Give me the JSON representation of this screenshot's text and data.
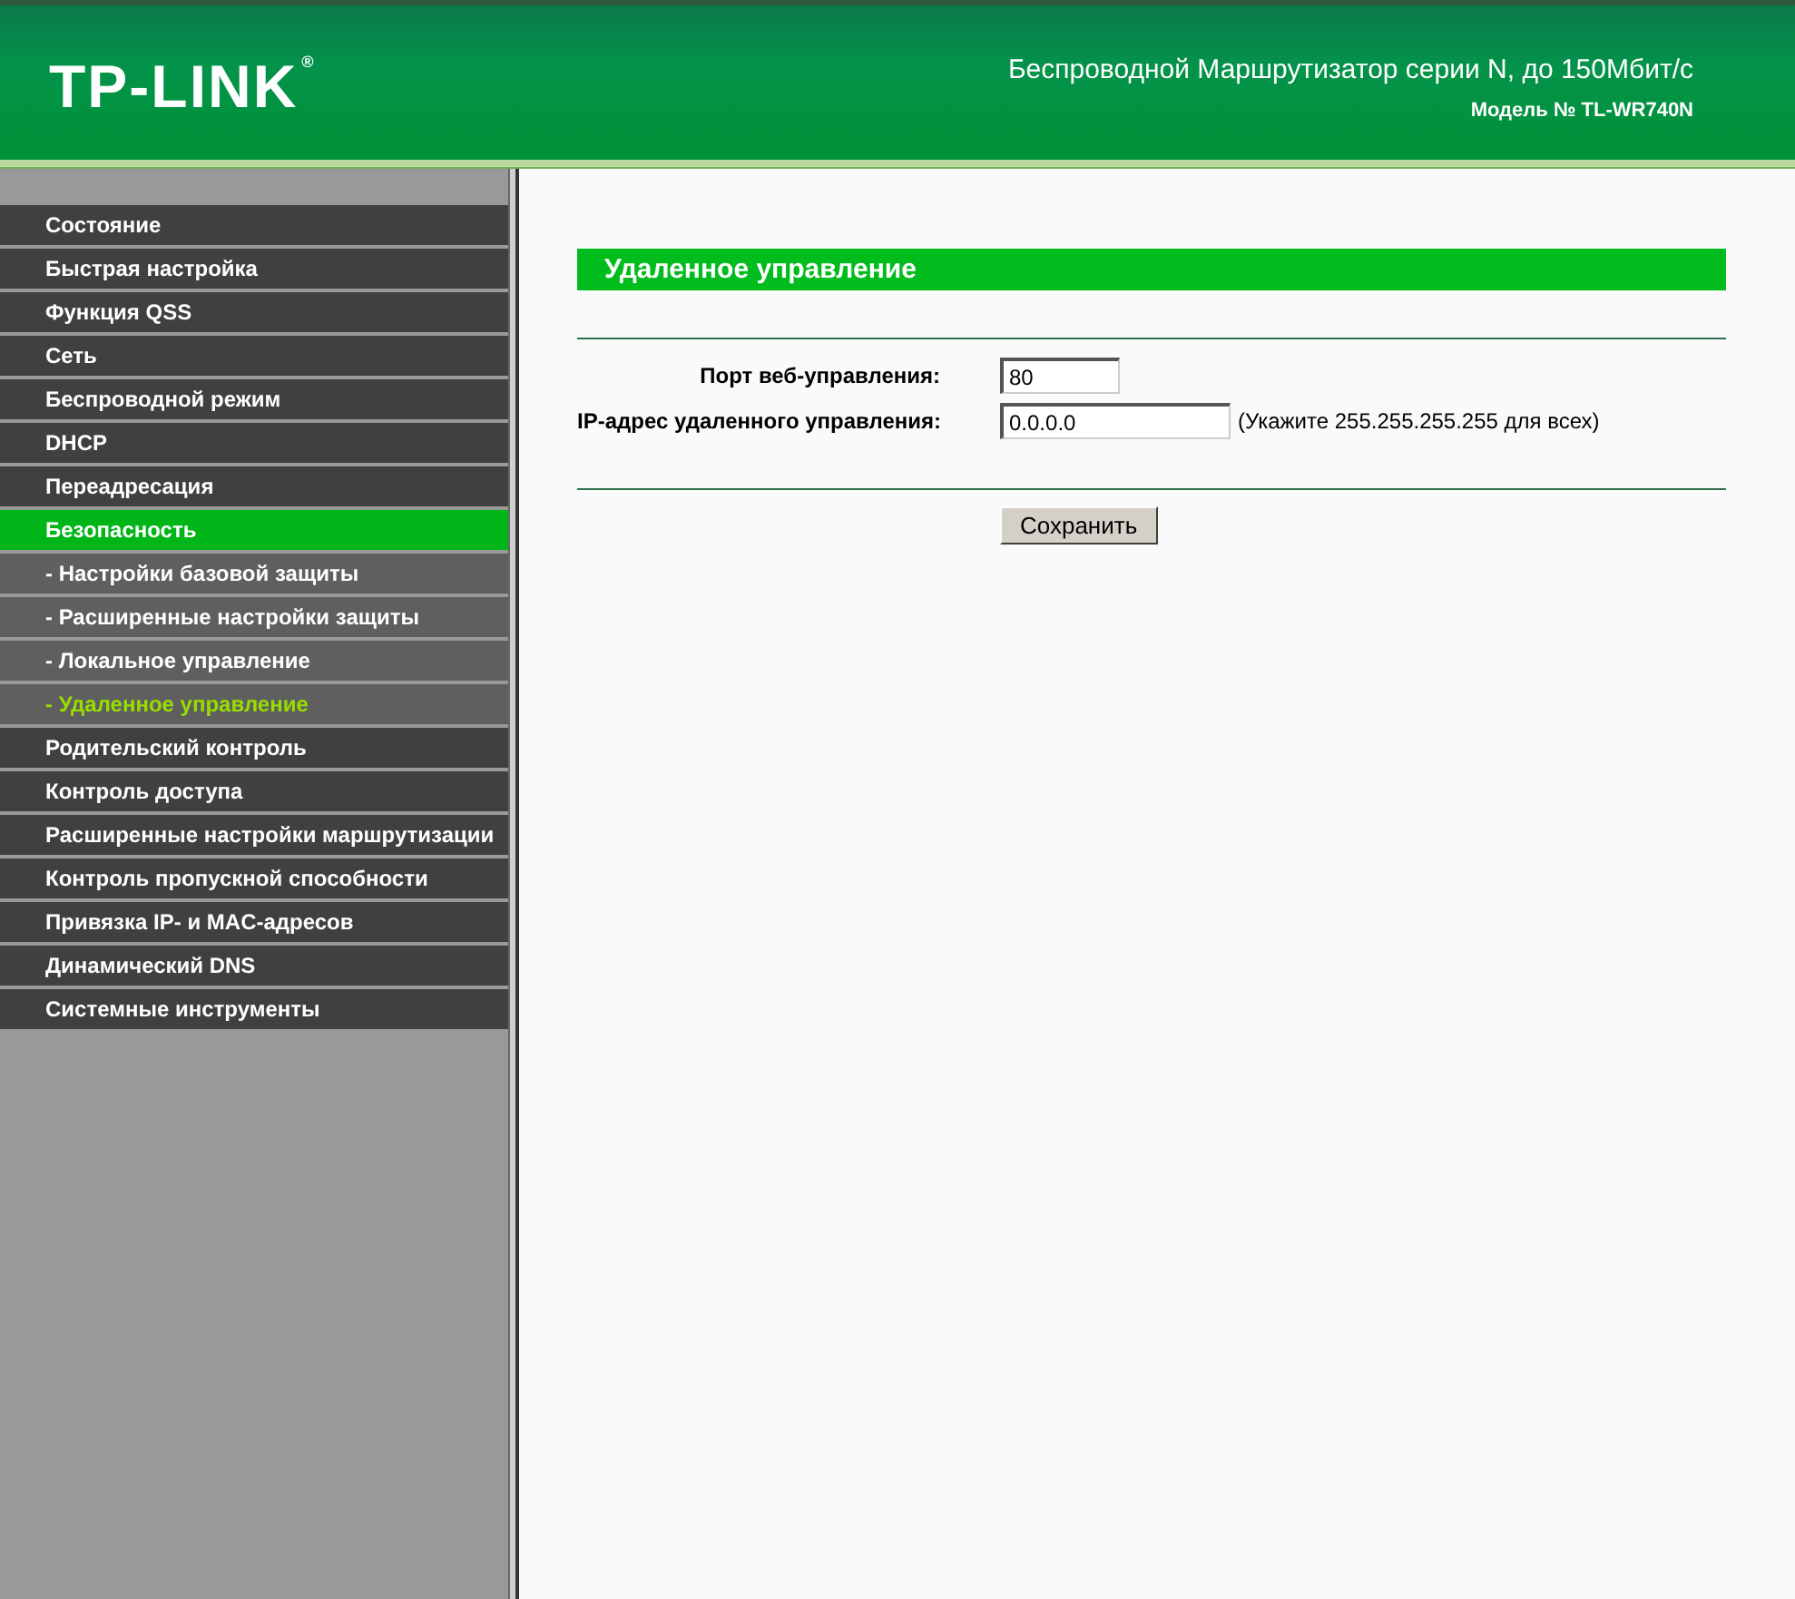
{
  "header": {
    "logo": "TP-LINK",
    "logo_mark": "®",
    "title": "Беспроводной Маршрутизатор серии N, до 150Мбит/с",
    "model": "Модель № TL-WR740N"
  },
  "sidebar": {
    "items": [
      {
        "label": "Состояние",
        "kind": "main",
        "selected": false
      },
      {
        "label": "Быстрая настройка",
        "kind": "main",
        "selected": false
      },
      {
        "label": "Функция QSS",
        "kind": "main",
        "selected": false
      },
      {
        "label": "Сеть",
        "kind": "main",
        "selected": false
      },
      {
        "label": "Беспроводной режим",
        "kind": "main",
        "selected": false
      },
      {
        "label": "DHCP",
        "kind": "main",
        "selected": false
      },
      {
        "label": "Переадресация",
        "kind": "main",
        "selected": false
      },
      {
        "label": "Безопасность",
        "kind": "main",
        "selected": true
      },
      {
        "label": "- Настройки базовой защиты",
        "kind": "sub",
        "selected": false
      },
      {
        "label": "- Расширенные настройки защиты",
        "kind": "sub",
        "selected": false
      },
      {
        "label": "- Локальное управление",
        "kind": "sub",
        "selected": false
      },
      {
        "label": "- Удаленное управление",
        "kind": "sub",
        "selected": true
      },
      {
        "label": "Родительский контроль",
        "kind": "main",
        "selected": false
      },
      {
        "label": "Контроль доступа",
        "kind": "main",
        "selected": false
      },
      {
        "label": "Расширенные настройки маршрутизации",
        "kind": "main",
        "selected": false
      },
      {
        "label": "Контроль пропускной способности",
        "kind": "main",
        "selected": false
      },
      {
        "label": "Привязка IP- и MAC-адресов",
        "kind": "main",
        "selected": false
      },
      {
        "label": "Динамический DNS",
        "kind": "main",
        "selected": false
      },
      {
        "label": "Системные инструменты",
        "kind": "main",
        "selected": false
      }
    ]
  },
  "content": {
    "title": "Удаленное управление",
    "fields": [
      {
        "label": "Порт веб-управления:",
        "value": "80",
        "kind": "short"
      },
      {
        "label": "IP-адрес удаленного управления:",
        "value": "0.0.0.0",
        "kind": "long",
        "hint": "(Укажите 255.255.255.255 для всех)"
      }
    ],
    "save_button": "Сохранить"
  }
}
